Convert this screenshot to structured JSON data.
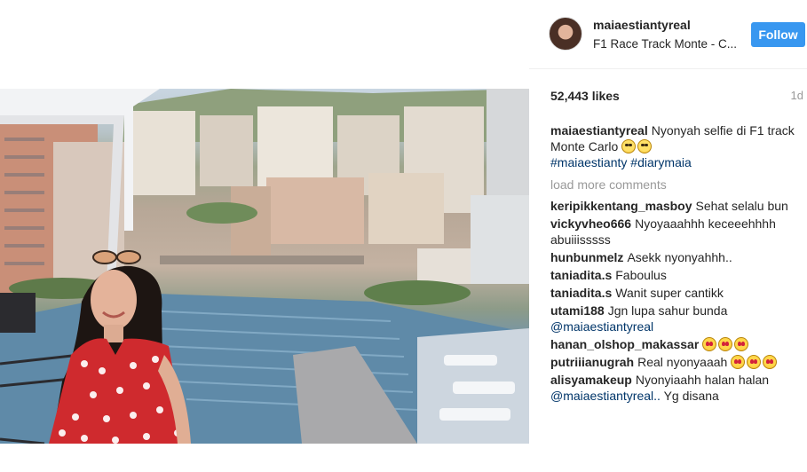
{
  "post": {
    "username": "maiaestiantyreal",
    "location": "F1 Race Track Monte - C...",
    "follow_label": "Follow",
    "likes": "52,443 likes",
    "time_ago": "1d"
  },
  "caption": {
    "username": "maiaestiantyreal",
    "text": "Nyonyah selfie di F1 track Monte Carlo",
    "hashtag_1": "#maiaestianty",
    "hashtag_2": "#diarymaia"
  },
  "load_more": "load more comments",
  "comments": [
    {
      "username": "keripikkentang_masboy",
      "text": "Sehat selalu bun"
    },
    {
      "username": "vickyvheo666",
      "text": "Nyoyaaahhh keceeehhhh abuiiisssss"
    },
    {
      "username": "hunbunmelz",
      "text": "Asekk nyonyahhh.."
    },
    {
      "username": "taniadita.s",
      "text": "Faboulus"
    },
    {
      "username": "taniadita.s",
      "text": "Wanit super cantikk"
    },
    {
      "username": "utami188",
      "text": "Jgn lupa sahur bunda",
      "mention": "@maiaestiantyreal"
    },
    {
      "username": "hanan_olshop_makassar",
      "text": ""
    },
    {
      "username": "putriiianugrah",
      "text": "Real nyonyaaah"
    },
    {
      "username": "alisyamakeup",
      "text": "Nyonyiaahh halan halan",
      "mention": "@maiaestiantyreal..",
      "text_after": " Yg disana"
    }
  ],
  "colors": {
    "follow_button": "#3897f0",
    "hashtag": "#003569",
    "muted": "#999999"
  }
}
